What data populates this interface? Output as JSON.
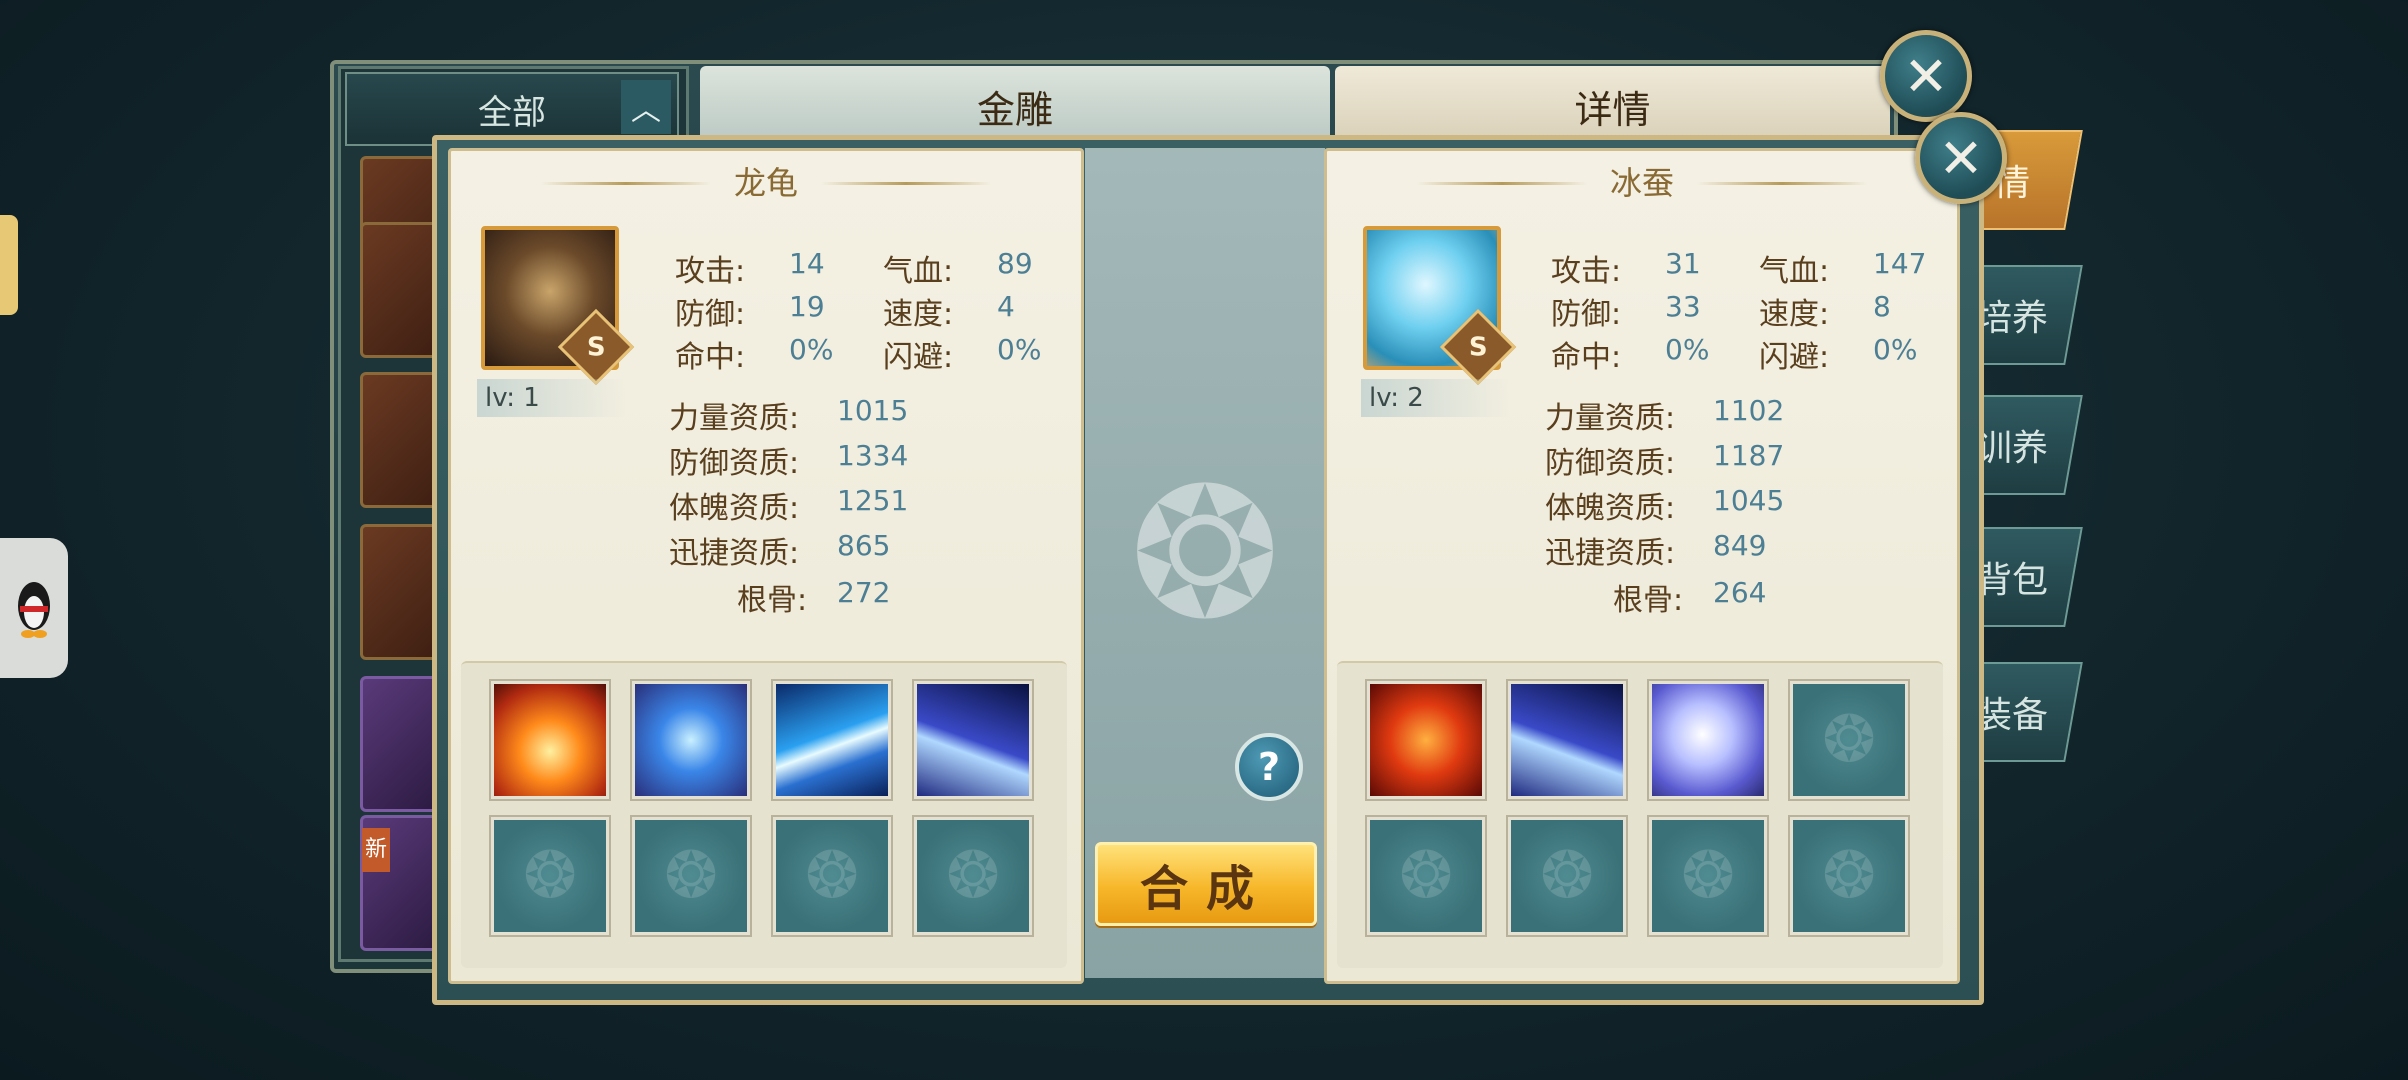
{
  "background": {
    "filter_label": "全部",
    "center_title": "金雕",
    "right_title": "详情",
    "tabs": [
      "情",
      "培养",
      "训养",
      "背包",
      "装备"
    ]
  },
  "dialog": {
    "compose_label": "合成",
    "help_label": "?",
    "left_pet": {
      "name": "龙龟",
      "level": "lv: 1",
      "grade": "S",
      "stats": [
        {
          "label": "攻击:",
          "value": "14"
        },
        {
          "label": "气血:",
          "value": "89"
        },
        {
          "label": "防御:",
          "value": "19"
        },
        {
          "label": "速度:",
          "value": "4"
        },
        {
          "label": "命中:",
          "value": "0%"
        },
        {
          "label": "闪避:",
          "value": "0%"
        }
      ],
      "aptitudes": [
        {
          "label": "力量资质:",
          "value": "1015"
        },
        {
          "label": "防御资质:",
          "value": "1334"
        },
        {
          "label": "体魄资质:",
          "value": "1251"
        },
        {
          "label": "迅捷资质:",
          "value": "865"
        },
        {
          "label": "根骨:",
          "value": "272"
        }
      ],
      "skills": [
        "fire-skill-icon",
        "shield-skill-icon",
        "wind-skill-icon",
        "claw-skill-icon"
      ]
    },
    "right_pet": {
      "name": "冰蚕",
      "level": "lv: 2",
      "grade": "S",
      "stats": [
        {
          "label": "攻击:",
          "value": "31"
        },
        {
          "label": "气血:",
          "value": "147"
        },
        {
          "label": "防御:",
          "value": "33"
        },
        {
          "label": "速度:",
          "value": "8"
        },
        {
          "label": "命中:",
          "value": "0%"
        },
        {
          "label": "闪避:",
          "value": "0%"
        }
      ],
      "aptitudes": [
        {
          "label": "力量资质:",
          "value": "1102"
        },
        {
          "label": "防御资质:",
          "value": "1187"
        },
        {
          "label": "体魄资质:",
          "value": "1045"
        },
        {
          "label": "迅捷资质:",
          "value": "849"
        },
        {
          "label": "根骨:",
          "value": "264"
        }
      ],
      "skills": [
        "flame-skill-icon",
        "claw-skill-icon",
        "orb-skill-icon"
      ]
    }
  },
  "list": {
    "new_badge": "新"
  }
}
